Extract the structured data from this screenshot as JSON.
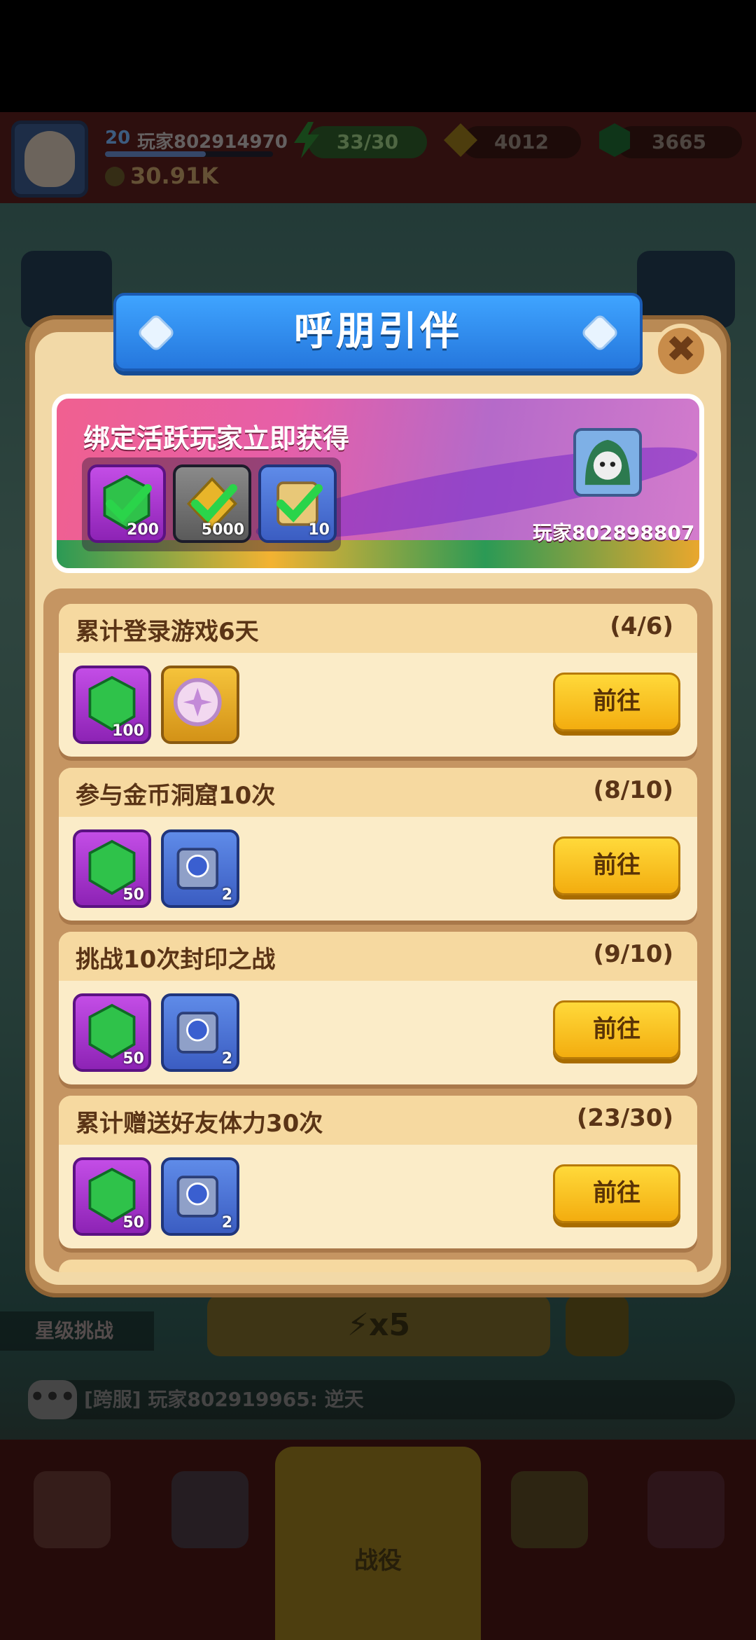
{
  "hud": {
    "level": "20",
    "player_name": "玩家802914970",
    "xp_progress": 0.6,
    "power": "30.91K",
    "energy": "33/30",
    "gold": "4012",
    "gems": "3665"
  },
  "background": {
    "star_challenge": "星级挑战",
    "energy_cost": "x5",
    "chat_tag": "[跨服]",
    "chat_sender": "玩家802919965:",
    "chat_message": "逆天",
    "chat_icon": "•••",
    "nav_center_label": "战役"
  },
  "dialog": {
    "title": "呼朋引伴",
    "close_glyph": "✖",
    "banner": {
      "headline": "绑定活跃玩家立即获得",
      "rewards": [
        {
          "icon": "gem-icon",
          "qty": "200",
          "claimed": true
        },
        {
          "icon": "gold-icon",
          "qty": "5000",
          "claimed": true
        },
        {
          "icon": "scroll-icon",
          "qty": "10",
          "claimed": true
        }
      ],
      "bound_player": "玩家802898807"
    },
    "tasks": [
      {
        "name": "累计登录游戏6天",
        "progress": "(4/6)",
        "rewards": [
          {
            "icon": "gem-icon",
            "qty": "100",
            "bg": "purple"
          },
          {
            "icon": "coin-icon",
            "qty": "",
            "bg": "gold"
          }
        ],
        "button": "前往"
      },
      {
        "name": "参与金币洞窟10次",
        "progress": "(8/10)",
        "rewards": [
          {
            "icon": "gem-icon",
            "qty": "50",
            "bg": "purple"
          },
          {
            "icon": "mystery-chest-icon",
            "qty": "2",
            "bg": "blue"
          }
        ],
        "button": "前往"
      },
      {
        "name": "挑战10次封印之战",
        "progress": "(9/10)",
        "rewards": [
          {
            "icon": "gem-icon",
            "qty": "50",
            "bg": "purple"
          },
          {
            "icon": "mystery-chest-icon",
            "qty": "2",
            "bg": "blue"
          }
        ],
        "button": "前往"
      },
      {
        "name": "累计赠送好友体力30次",
        "progress": "(23/30)",
        "rewards": [
          {
            "icon": "gem-icon",
            "qty": "50",
            "bg": "purple"
          },
          {
            "icon": "mystery-chest-icon",
            "qty": "2",
            "bg": "blue"
          }
        ],
        "button": "前往"
      }
    ]
  },
  "colors": {
    "ribbon_blue": "#2f8cf0",
    "go_button_yellow": "#ffc824",
    "panel_tan": "#f2d9a7",
    "task_header": "#f6d9a0"
  }
}
